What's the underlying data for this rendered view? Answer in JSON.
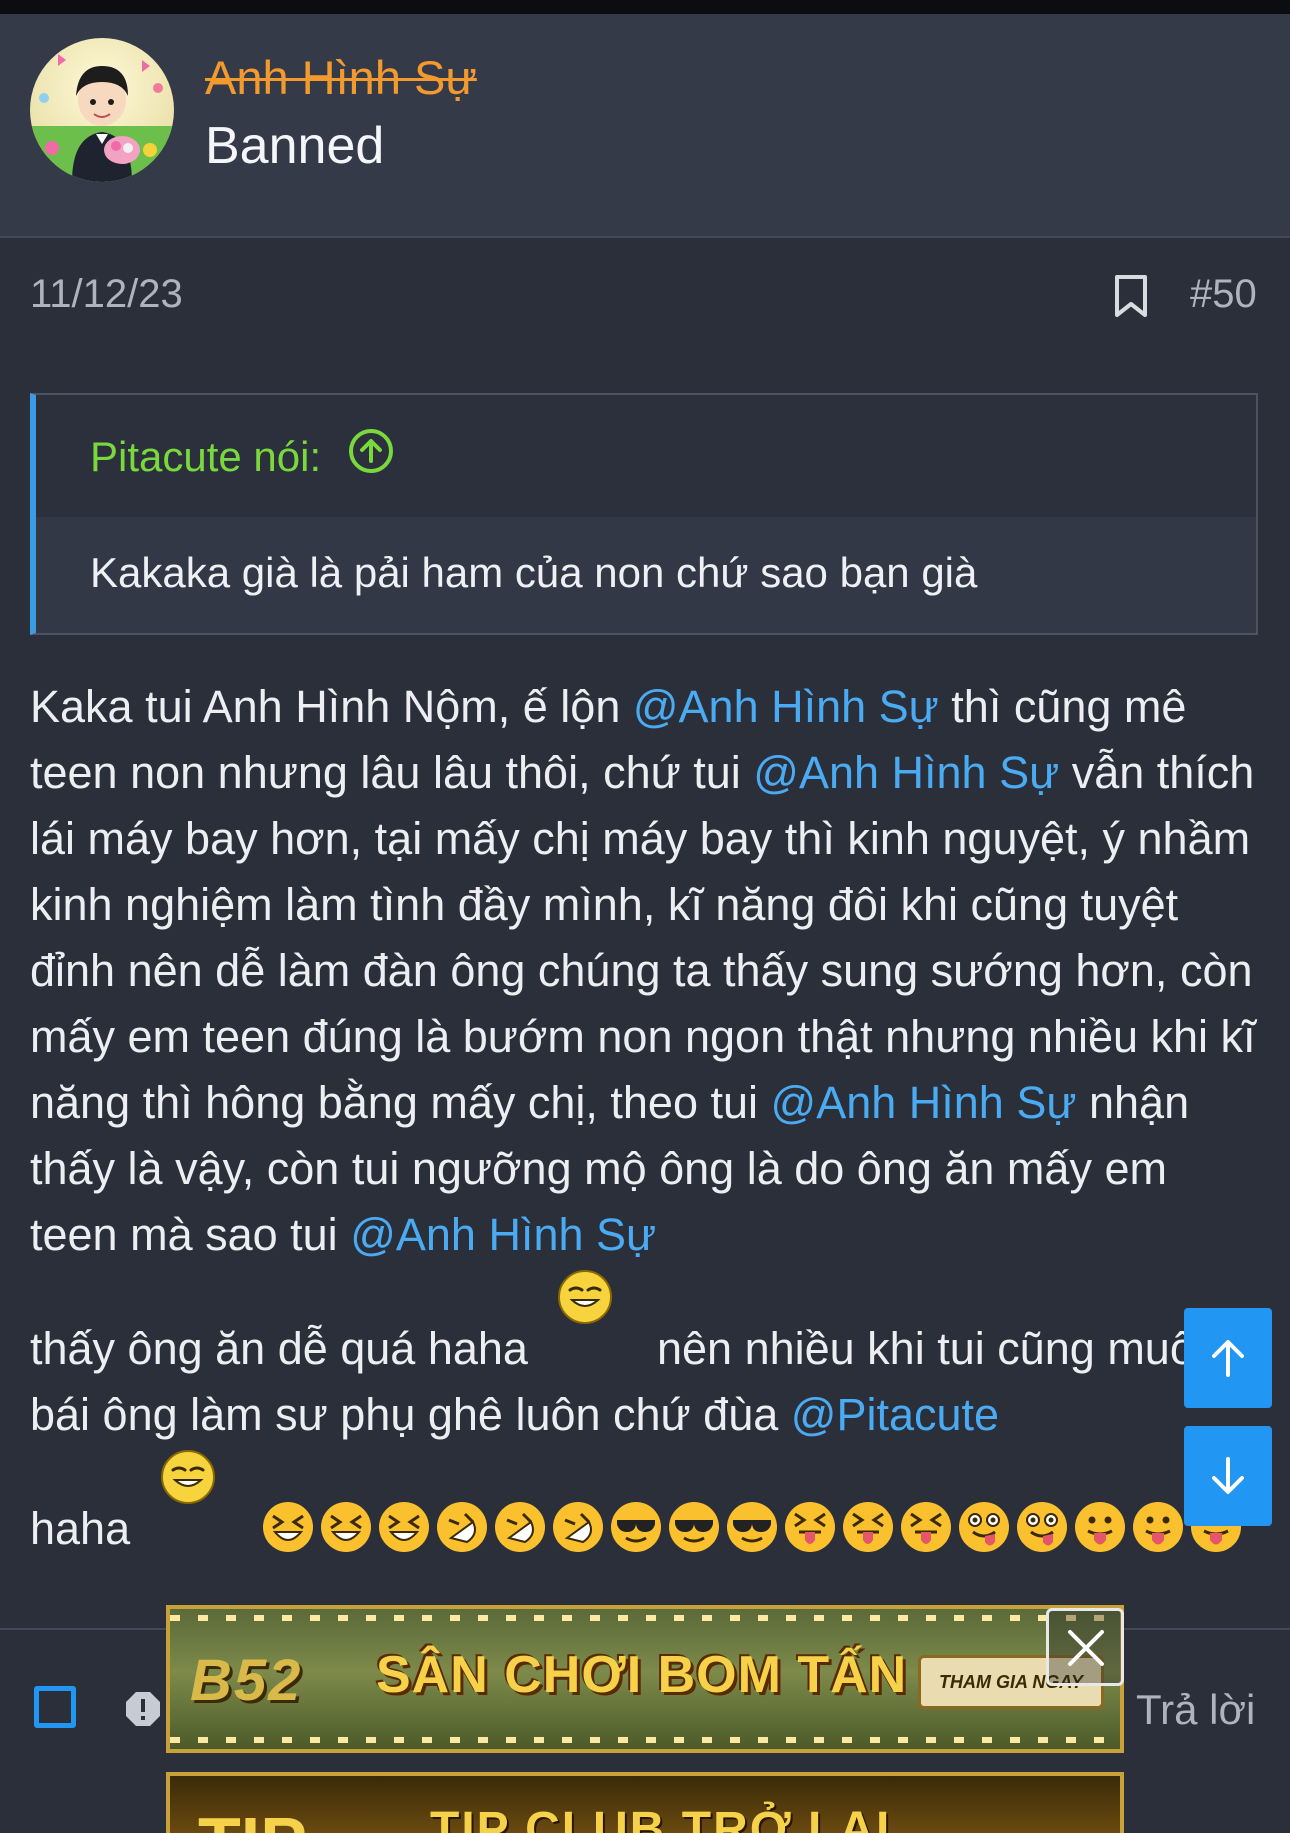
{
  "post": {
    "username": "Anh Hình Sự",
    "user_title": "Banned",
    "date": "11/12/23",
    "post_number": "#50"
  },
  "quote": {
    "author": "Pitacute nói:",
    "body": "Kakaka già là pải ham của non chứ sao bạn già"
  },
  "message": {
    "p1": "Kaka tui Anh Hình Nộm, ế lộn ",
    "m1": "@Anh Hình Sự",
    "p2": " thì cũng mê teen non nhưng lâu lâu thôi, chứ tui ",
    "m2": "@Anh Hình Sự",
    "p3": " vẫn thích lái máy bay hơn, tại mấy chị máy bay thì kinh nguyệt, ý nhầm kinh nghiệm làm tình đầy mình, kĩ năng đôi khi cũng tuyệt đỉnh nên dễ làm đàn ông chúng ta thấy sung sướng hơn, còn mấy em teen đúng là bướm non ngon thật nhưng nhiều khi kĩ năng thì hông bằng mấy chị, theo tui ",
    "m3": "@Anh Hình Sự",
    "p4": " nhận thấy là vậy, còn tui ngưỡng mộ ông là do ông ăn mấy em teen mà sao tui ",
    "m4": "@Anh Hình Sự",
    "p5": "thấy ông ăn dễ quá haha",
    "p6": "nên nhiều khi tui cũng muốn bái ông làm sư phụ ghê luôn chứ đùa ",
    "m5": "@Pitacute",
    "p7": "haha"
  },
  "footer": {
    "reply_label": "Trả lời"
  },
  "ad": {
    "logo": "B52",
    "headline": "SÂN CHƠI BOM TẤN",
    "cta": "THAM GIA NGAY",
    "second_big": "TIP",
    "second_text": "TIP CLUB TRỞ LẠI"
  },
  "colors": {
    "background": "#2b2f3a",
    "username": "#f39a2e",
    "mention": "#4aaaf2",
    "quote_author": "#79d93c",
    "accent_blue": "#2196f3"
  },
  "icons": [
    "avatar-image",
    "bookmark-icon",
    "arrow-up-circle-icon",
    "arrow-up-icon",
    "arrow-down-icon",
    "checkbox-icon",
    "report-icon",
    "close-icon",
    "emoji-smile",
    "emoji-laughing",
    "emoji-rofl",
    "emoji-sunglasses",
    "emoji-squint-tongue",
    "emoji-wink-tongue",
    "emoji-tongue"
  ]
}
